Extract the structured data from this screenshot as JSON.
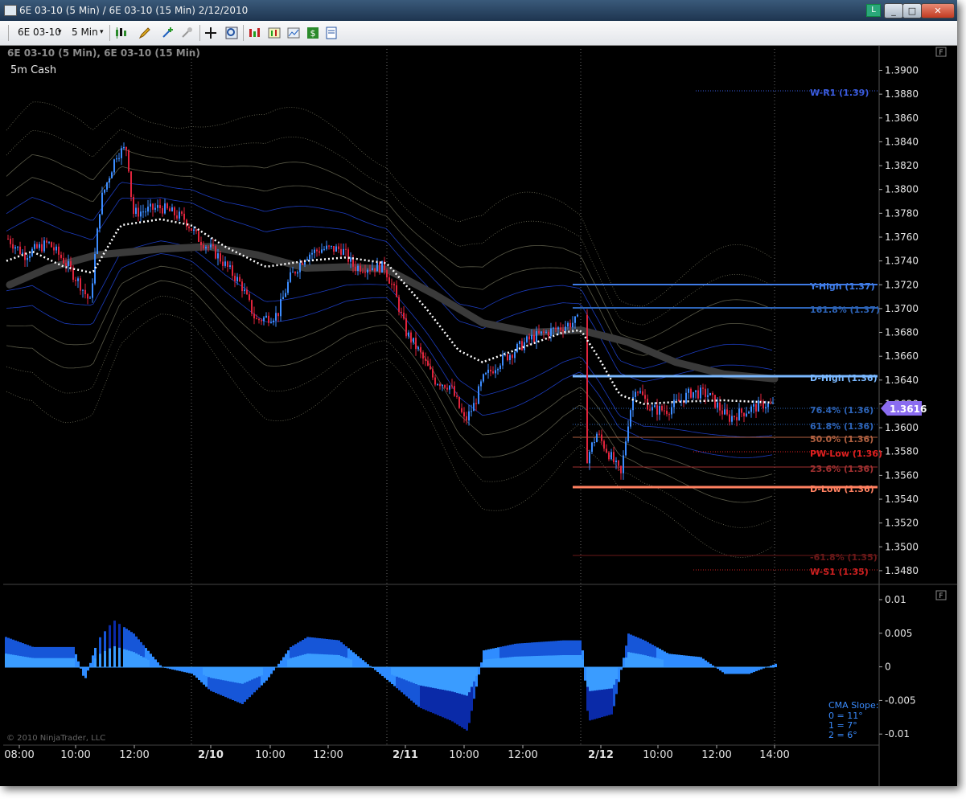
{
  "window": {
    "title": "6E 03-10 (5 Min) / 6E 03-10 (15 Min)  2/12/2010",
    "link_label": "L",
    "minimize": "_",
    "maximize": "□",
    "close": "✕"
  },
  "toolbar": {
    "instrument": "6E 03-10",
    "interval": "5 Min",
    "dropdown_arrow": "▾",
    "icons": [
      "candlestick-icon",
      "pencil-icon",
      "crosshair-plus-icon",
      "pin-icon",
      "move-cursor-icon",
      "zoom-icon",
      "indicators-icon",
      "strategies-icon",
      "chart-properties-icon",
      "dollar-icon",
      "data-box-icon"
    ]
  },
  "chart": {
    "header": "6E 03-10 (5 Min), 6E 03-10 (15 Min)",
    "subheader": "5m Cash",
    "copyright": "© 2010 NinjaTrader, LLC",
    "panel_marker": "F",
    "current_price": "1.3616",
    "y_ticks": [
      "1.3900",
      "1.3880",
      "1.3860",
      "1.3840",
      "1.3820",
      "1.3800",
      "1.3780",
      "1.3760",
      "1.3740",
      "1.3720",
      "1.3700",
      "1.3680",
      "1.3660",
      "1.3640",
      "1.3620",
      "1.3600",
      "1.3580",
      "1.3560",
      "1.3540",
      "1.3520",
      "1.3500",
      "1.3480"
    ],
    "osc_ticks": [
      "0.01",
      "0.005",
      "0",
      "-0.005",
      "-0.01"
    ],
    "x_ticks": [
      "08:00",
      "10:00",
      "12:00",
      "2/10",
      "10:00",
      "12:00",
      "2/11",
      "10:00",
      "12:00",
      "2/12",
      "10:00",
      "12:00",
      "14:00"
    ],
    "levels": [
      {
        "label": "W-R1 (1.39)",
        "color": "#3a5ce0"
      },
      {
        "label": "Y-High (1.37)",
        "color": "#3f7be6"
      },
      {
        "label": "161.8% (1.37)",
        "color": "#2d64b8"
      },
      {
        "label": "D-High (1.36)",
        "color": "#7ab8ff"
      },
      {
        "label": "76.4% (1.36)",
        "color": "#2d64b8"
      },
      {
        "label": "61.8% (1.36)",
        "color": "#2d64b8"
      },
      {
        "label": "50.0% (1.36)",
        "color": "#b06040"
      },
      {
        "label": "PW-Low (1.36)",
        "color": "#e02020"
      },
      {
        "label": "23.6% (1.36)",
        "color": "#a03030"
      },
      {
        "label": "D-Low (1.36)",
        "color": "#ff8060"
      },
      {
        "label": "-61.8% (1.35)",
        "color": "#6a1818"
      },
      {
        "label": "W-S1 (1.35)",
        "color": "#cc2020"
      }
    ],
    "cma_slope": {
      "title": "CMA Slope:",
      "lines": [
        "0 = 11°",
        "1 = 7°",
        "2 = 6°"
      ]
    },
    "colors": {
      "up_bar": "#3c8cff",
      "down_bar": "#e0243c",
      "cma": "#ffffff",
      "bands": "#1c3cbe",
      "price_badge": "#8a6cf0"
    }
  }
}
